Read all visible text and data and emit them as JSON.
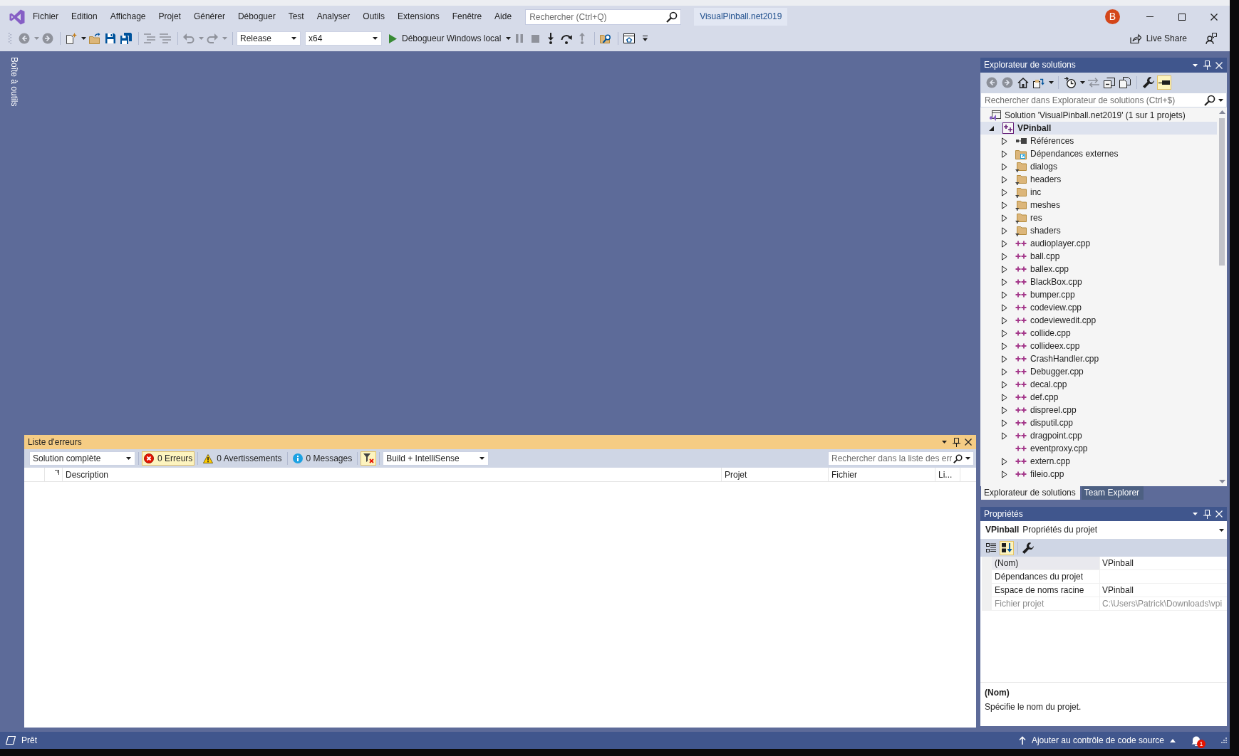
{
  "window": {
    "title": "VisualPinball.net2019",
    "account_initial": "B"
  },
  "menu": [
    "Fichier",
    "Edition",
    "Affichage",
    "Projet",
    "Générer",
    "Déboguer",
    "Test",
    "Analyser",
    "Outils",
    "Extensions",
    "Fenêtre",
    "Aide"
  ],
  "search": {
    "placeholder": "Rechercher (Ctrl+Q)"
  },
  "toolbar": {
    "groups": [
      [
        {
          "kind": "back",
          "disabled": true
        },
        {
          "kind": "dropdown",
          "disabled": true
        },
        {
          "kind": "forward",
          "disabled": true
        }
      ],
      [
        {
          "kind": "new-project",
          "disabled": false
        },
        {
          "kind": "dropdown",
          "disabled": false
        },
        {
          "kind": "open",
          "disabled": false
        },
        {
          "kind": "save",
          "disabled": false
        },
        {
          "kind": "save-all",
          "disabled": false
        }
      ],
      [
        {
          "kind": "comment",
          "disabled": true
        },
        {
          "kind": "uncomment",
          "disabled": true
        }
      ],
      [
        {
          "kind": "undo",
          "disabled": true
        },
        {
          "kind": "dropdown",
          "disabled": true
        },
        {
          "kind": "redo",
          "disabled": true
        },
        {
          "kind": "dropdown",
          "disabled": true
        }
      ],
      [
        {
          "kind": "combo",
          "value": "Release",
          "disabled": false
        },
        {
          "kind": "combo",
          "value": "x64",
          "disabled": false
        },
        {
          "kind": "start",
          "label": "Débogueur Windows local",
          "disabled": false
        },
        {
          "kind": "dropdown",
          "disabled": false
        },
        {
          "kind": "pause",
          "disabled": true
        },
        {
          "kind": "stop",
          "disabled": true
        },
        {
          "kind": "step-into",
          "disabled": false
        },
        {
          "kind": "step-over",
          "disabled": false
        },
        {
          "kind": "step-out",
          "disabled": true
        }
      ],
      [
        {
          "kind": "find-in-files",
          "disabled": false
        }
      ],
      [
        {
          "kind": "screen",
          "disabled": false
        },
        {
          "kind": "overflow",
          "disabled": false
        }
      ]
    ],
    "live_share": "Live Share"
  },
  "toolbox": {
    "label": "Boîte à outils"
  },
  "error_list": {
    "title": "Liste d'erreurs",
    "scope": "Solution complète",
    "filters": [
      {
        "kind": "error",
        "label": "0 Erreurs",
        "selected": true
      },
      {
        "kind": "warning",
        "label": "0 Avertissements",
        "selected": false
      },
      {
        "kind": "message",
        "label": "0 Messages",
        "selected": false
      }
    ],
    "filter_toggle": {
      "selected": true
    },
    "source": "Build + IntelliSense",
    "search": {
      "placeholder": "Rechercher dans la liste des err"
    },
    "columns": [
      "Description",
      "Projet",
      "Fichier",
      "Li..."
    ]
  },
  "solution_explorer": {
    "title": "Explorateur de solutions",
    "toolbar": [
      [
        {
          "kind": "back",
          "disabled": true,
          "selected": false
        },
        {
          "kind": "forward",
          "disabled": true,
          "selected": false
        },
        {
          "kind": "home",
          "disabled": false,
          "selected": false
        },
        {
          "kind": "switch-views",
          "disabled": false,
          "selected": false
        },
        {
          "kind": "dropdown",
          "disabled": false,
          "selected": false
        }
      ],
      [
        {
          "kind": "pending",
          "disabled": false,
          "selected": false
        },
        {
          "kind": "dropdown",
          "disabled": false,
          "selected": false
        },
        {
          "kind": "sync",
          "disabled": true,
          "selected": false
        },
        {
          "kind": "collapse-all",
          "disabled": false,
          "selected": false
        },
        {
          "kind": "show-all-files",
          "disabled": false,
          "selected": false
        }
      ],
      [
        {
          "kind": "properties",
          "disabled": false,
          "selected": false
        },
        {
          "kind": "preview",
          "disabled": false,
          "selected": true
        }
      ]
    ],
    "search": {
      "placeholder": "Rechercher dans Explorateur de solutions (Ctrl+$)"
    },
    "tree": [
      {
        "label": "Solution 'VisualPinball.net2019' (1 sur 1 projets)",
        "kind": "solution",
        "selected": false,
        "children": [
          {
            "label": "VPinball",
            "kind": "project",
            "expanded": true,
            "selected": true,
            "children": [
              {
                "label": "Références",
                "kind": "references",
                "expanded": false,
                "selected": false
              },
              {
                "label": "Dépendances externes",
                "kind": "external",
                "expanded": false,
                "selected": false
              },
              {
                "label": "dialogs",
                "kind": "folder",
                "expanded": false,
                "selected": false
              },
              {
                "label": "headers",
                "kind": "folder",
                "expanded": false,
                "selected": false
              },
              {
                "label": "inc",
                "kind": "folder",
                "expanded": false,
                "selected": false
              },
              {
                "label": "meshes",
                "kind": "folder",
                "expanded": false,
                "selected": false
              },
              {
                "label": "res",
                "kind": "folder",
                "expanded": false,
                "selected": false
              },
              {
                "label": "shaders",
                "kind": "folder",
                "expanded": false,
                "selected": false
              },
              {
                "label": "audioplayer.cpp",
                "kind": "cpp",
                "expanded": false,
                "selected": false
              },
              {
                "label": "ball.cpp",
                "kind": "cpp",
                "expanded": false,
                "selected": false
              },
              {
                "label": "ballex.cpp",
                "kind": "cpp",
                "expanded": false,
                "selected": false
              },
              {
                "label": "BlackBox.cpp",
                "kind": "cpp",
                "expanded": false,
                "selected": false
              },
              {
                "label": "bumper.cpp",
                "kind": "cpp",
                "expanded": false,
                "selected": false
              },
              {
                "label": "codeview.cpp",
                "kind": "cpp",
                "expanded": false,
                "selected": false
              },
              {
                "label": "codeviewedit.cpp",
                "kind": "cpp",
                "expanded": false,
                "selected": false
              },
              {
                "label": "collide.cpp",
                "kind": "cpp",
                "expanded": false,
                "selected": false
              },
              {
                "label": "collideex.cpp",
                "kind": "cpp",
                "expanded": false,
                "selected": false
              },
              {
                "label": "CrashHandler.cpp",
                "kind": "cpp",
                "expanded": false,
                "selected": false
              },
              {
                "label": "Debugger.cpp",
                "kind": "cpp",
                "expanded": false,
                "selected": false
              },
              {
                "label": "decal.cpp",
                "kind": "cpp",
                "expanded": false,
                "selected": false
              },
              {
                "label": "def.cpp",
                "kind": "cpp",
                "expanded": false,
                "selected": false
              },
              {
                "label": "dispreel.cpp",
                "kind": "cpp",
                "expanded": false,
                "selected": false
              },
              {
                "label": "disputil.cpp",
                "kind": "cpp",
                "expanded": false,
                "selected": false
              },
              {
                "label": "dragpoint.cpp",
                "kind": "cpp",
                "expanded": false,
                "selected": false
              },
              {
                "label": "eventproxy.cpp",
                "kind": "cpp",
                "selected": false
              },
              {
                "label": "extern.cpp",
                "kind": "cpp",
                "expanded": false,
                "selected": false
              },
              {
                "label": "fileio.cpp",
                "kind": "cpp",
                "expanded": false,
                "selected": false
              }
            ]
          }
        ]
      }
    ],
    "tabs": [
      {
        "label": "Explorateur de solutions",
        "selected": true
      },
      {
        "label": "Team Explorer",
        "selected": false
      }
    ]
  },
  "properties": {
    "title": "Propriétés",
    "object_name": "VPinball",
    "object_type": "Propriétés du projet",
    "toolbar": [
      [
        {
          "kind": "categorized",
          "selected": false
        },
        {
          "kind": "alphabetical",
          "selected": true
        }
      ],
      [
        {
          "kind": "property-pages",
          "selected": false
        }
      ]
    ],
    "rows": [
      {
        "name": "(Nom)",
        "value": "VPinball",
        "selected": true,
        "disabled": false
      },
      {
        "name": "Dépendances du projet",
        "selected": false,
        "disabled": false
      },
      {
        "name": "Espace de noms racine",
        "value": "VPinball",
        "selected": false,
        "disabled": false
      },
      {
        "name": "Fichier projet",
        "value": "C:\\Users\\Patrick\\Downloads\\vpi",
        "selected": false,
        "disabled": true
      }
    ],
    "description": {
      "title": "(Nom)",
      "text": "Spécifie le nom du projet."
    }
  },
  "status_bar": {
    "text": "Prêt",
    "source_control": "Ajouter au contrôle de code source",
    "notifications": "1"
  }
}
